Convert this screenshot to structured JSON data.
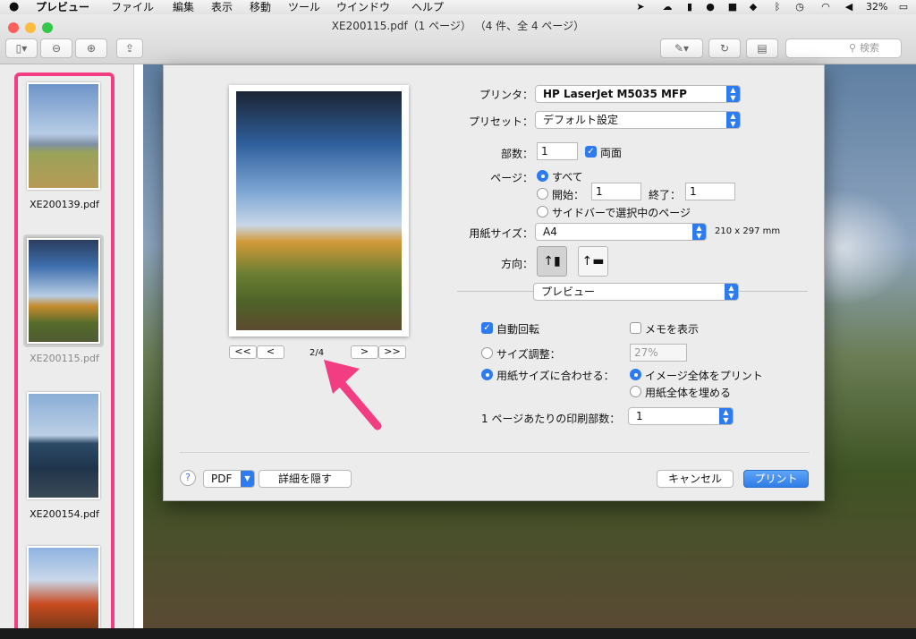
{
  "menubar": {
    "apple": "",
    "app": "プレビュー",
    "items": [
      "ファイル",
      "編集",
      "表示",
      "移動",
      "ツール",
      "ウインドウ",
      "ヘルプ"
    ],
    "battery": "32%"
  },
  "window": {
    "title": "XE200115.pdf（1 ページ） （4 件、全 4 ページ）",
    "search_placeholder": "検索"
  },
  "sidebar": {
    "files": [
      "XE200139.pdf",
      "XE200115.pdf",
      "XE200154.pdf"
    ]
  },
  "print": {
    "printer_label": "プリンタ：",
    "printer": "HP LaserJet M5035 MFP",
    "preset_label": "プリセット：",
    "preset": "デフォルト設定",
    "copies_label": "部数：",
    "copies": "1",
    "duplex": "両面",
    "pages_label": "ページ：",
    "all": "すべて",
    "from_label": "開始：",
    "from": "1",
    "to_label": "終了：",
    "to": "1",
    "sidebar_pages": "サイドバーで選択中のページ",
    "paper_label": "用紙サイズ：",
    "paper": "A4",
    "paper_dims": "210 x 297 mm",
    "orientation_label": "方向：",
    "app_section": "プレビュー",
    "auto_rotate": "自動回転",
    "show_notes": "メモを表示",
    "scale_label": "サイズ調整：",
    "scale": "27%",
    "fit_label": "用紙サイズに合わせる：",
    "print_entire": "イメージ全体をプリント",
    "fill_paper": "用紙全体を埋める",
    "per_page_label": "1 ページあたりの印刷部数：",
    "per_page": "1",
    "page_indicator": "2/4",
    "nav_first": "<<",
    "nav_prev": "<",
    "nav_next": ">",
    "nav_last": ">>",
    "help": "?",
    "pdf": "PDF",
    "hide_details": "詳細を隠す",
    "cancel": "キャンセル",
    "print": "プリント"
  }
}
